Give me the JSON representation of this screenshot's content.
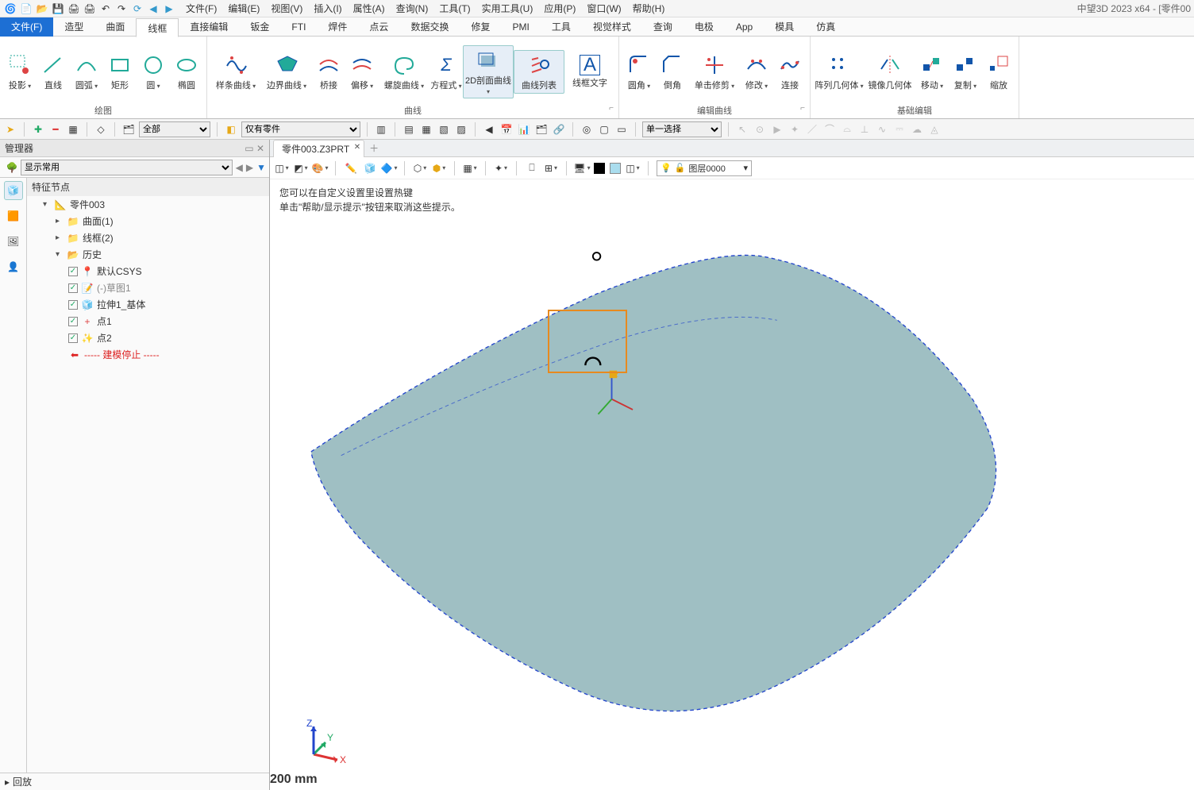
{
  "title": "中望3D 2023 x64 - [零件00",
  "menus": [
    "文件(F)",
    "编辑(E)",
    "视图(V)",
    "插入(I)",
    "属性(A)",
    "查询(N)",
    "工具(T)",
    "实用工具(U)",
    "应用(P)",
    "窗口(W)",
    "帮助(H)"
  ],
  "ribbon_tabs": [
    "文件(F)",
    "造型",
    "曲面",
    "线框",
    "直接编辑",
    "钣金",
    "FTI",
    "焊件",
    "点云",
    "数据交换",
    "修复",
    "PMI",
    "工具",
    "视觉样式",
    "查询",
    "电极",
    "App",
    "模具",
    "仿真"
  ],
  "active_ribbon_tab": "线框",
  "groups": {
    "draw": {
      "name": "绘图",
      "items": [
        "投影",
        "直线",
        "圆弧",
        "矩形",
        "圆",
        "椭圆"
      ]
    },
    "curve": {
      "name": "曲线",
      "items": [
        "样条曲线",
        "边界曲线",
        "桥接",
        "偏移",
        "螺旋曲线",
        "方程式",
        "2D剖面曲线",
        "曲线列表",
        "线框文字"
      ]
    },
    "edit": {
      "name": "编辑曲线",
      "items": [
        "圆角",
        "倒角",
        "单击修剪",
        "修改",
        "连接"
      ]
    },
    "basic": {
      "name": "基础编辑",
      "items": [
        "阵列几何体",
        "镜像几何体",
        "移动",
        "复制",
        "缩放"
      ]
    }
  },
  "filter1": "全部",
  "filter2": "仅有零件",
  "select_mode": "单一选择",
  "manager_title": "管理器",
  "display_filter": "显示常用",
  "tree_section": "特征节点",
  "tree": {
    "root": "零件003",
    "n1": "曲面(1)",
    "n2": "线框(2)",
    "n3": "历史",
    "h1": "默认CSYS",
    "h2": "(-)草图1",
    "h3": "拉伸1_基体",
    "h4": "点1",
    "h5": "点2",
    "stop": "----- 建模停止 -----"
  },
  "playback": "回放",
  "doc_tab": "零件003.Z3PRT",
  "layer": "图层0000",
  "hint1": "您可以在自定义设置里设置热键",
  "hint2": "单击\"帮助/显示提示\"按钮来取消这些提示。",
  "scale": "200 mm",
  "axis": {
    "x": "X",
    "y": "Y",
    "z": "Z"
  }
}
